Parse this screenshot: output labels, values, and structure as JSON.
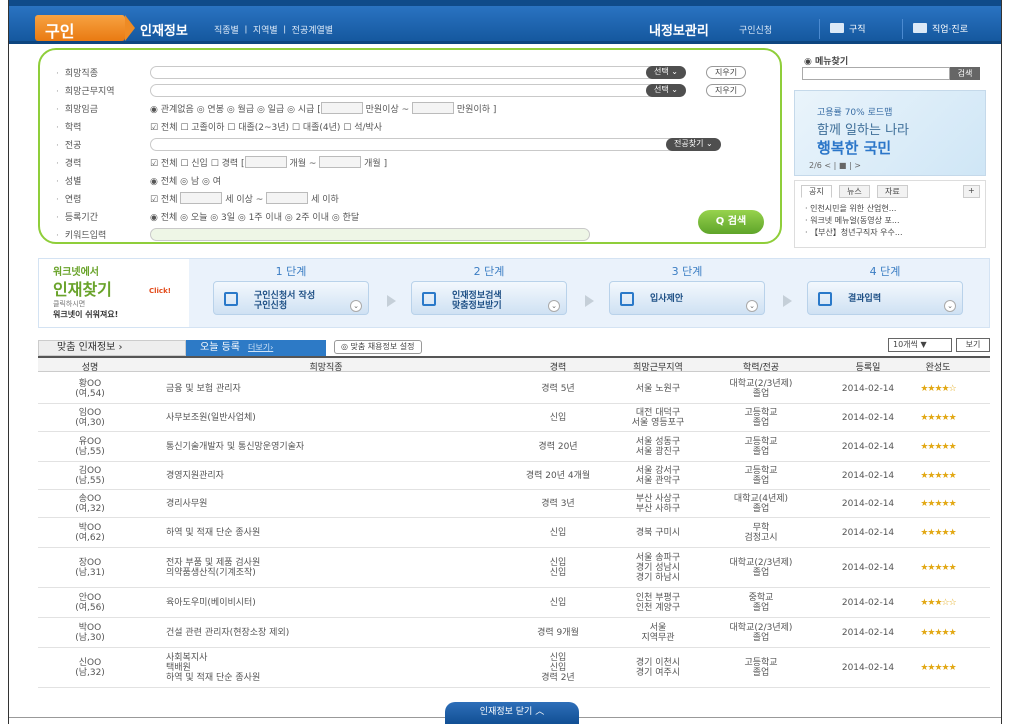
{
  "header": {
    "logo": "구인",
    "title": "인재정보",
    "subnav": "직종별 ㅣ 지역별 ㅣ 전공계열별",
    "my_info": "내정보관리",
    "request": "구인신청",
    "btn_jobs": "구직",
    "btn_career": "직업·진로",
    "colors": {
      "header_bg": "#1f66b3",
      "accent_green": "#8fce3a",
      "logo_orange": "#f19532"
    }
  },
  "search": {
    "fields": [
      {
        "label": "희망직종",
        "btn_select": "선택 ⌄",
        "btn_clear": "지우기"
      },
      {
        "label": "희망근무지역",
        "btn_select": "선택 ⌄",
        "btn_clear": "지우기"
      },
      {
        "label": "희망임금",
        "options": "◉ 관계없음  ◎ 연봉  ◎ 월급  ◎ 일급  ◎ 시급  [",
        "unit1": "만원이상 ~",
        "unit2": "만원이하 ]"
      },
      {
        "label": "학력",
        "options": "☑ 전체  ☐ 고졸이하  ☐ 대졸(2~3년)  ☐ 대졸(4년)  ☐ 석/박사"
      },
      {
        "label": "전공",
        "btn_find": "전공찾기 ⌄"
      },
      {
        "label": "경력",
        "options": "☑ 전체  ☐ 신입  ☐ 경력  [",
        "unit1": "개월 ~",
        "unit2": "개월 ]"
      },
      {
        "label": "성별",
        "options": "◉ 전체  ◎ 남  ◎ 여"
      },
      {
        "label": "연령",
        "options": "☑ 전체",
        "unit1": "세 이상 ~",
        "unit2": "세 이하"
      },
      {
        "label": "등록기간",
        "options": "◉ 전체  ◎ 오늘  ◎ 3일  ◎ 1주 이내  ◎ 2주 이내  ◎ 한달"
      },
      {
        "label": "키워드입력"
      }
    ],
    "search_button": "Q 검색"
  },
  "sidebar": {
    "menu_find_title": "◉ 메뉴찾기",
    "menu_find_button": "검색",
    "banner": {
      "line1": "고용률 70% 로드맵",
      "line2": "함께 일하는 나라",
      "line3": "행복한 국민",
      "pager": "2/6  < | ■ | >"
    },
    "news_tabs": [
      "공지",
      "뉴스",
      "자료",
      "+"
    ],
    "news_items": [
      "· 인천시민을 위한 산업현...",
      "· 워크넷 메뉴얼(동영상 포...",
      "· 【부산】청년구직자 우수..."
    ]
  },
  "steps": {
    "intro": {
      "line1": "워크넷에서",
      "line2": "인재찾기",
      "click": "Click!",
      "line3": "클릭하시면",
      "line4": "워크넷이 쉬워져요!"
    },
    "items": [
      {
        "num": "1 단계",
        "text": "구인신청서 작성\n구인신청"
      },
      {
        "num": "2 단계",
        "text": "인재정보검색\n맞춤정보받기"
      },
      {
        "num": "3 단계",
        "text": "입사제안"
      },
      {
        "num": "4 단계",
        "text": "결과입력"
      }
    ]
  },
  "tabs": {
    "tab1": "맞춤 인재정보 ›",
    "tab2": "오늘 등록",
    "tab2_more": "더보기›",
    "tab3": "◎ 맞춤 채용정보 설정",
    "select": "10개씩 ▼",
    "view": "보기"
  },
  "table": {
    "headers": [
      "성명",
      "희망직종",
      "경력",
      "희망근무지역",
      "학력/전공",
      "등록일",
      "완성도"
    ],
    "rows": [
      {
        "name": "황OO\n(여,54)",
        "job": "금융 및 보험 관리자",
        "career": "경력 5년",
        "region": "서울 노원구",
        "edu": "대학교(2/3년제)\n졸업",
        "date": "2014-02-14",
        "stars": "★★★★☆"
      },
      {
        "name": "임OO\n(여,30)",
        "job": "사무보조원(일반사업체)",
        "career": "신입",
        "region": "대전 대덕구\n서울 영등포구",
        "edu": "고등학교\n졸업",
        "date": "2014-02-14",
        "stars": "★★★★★"
      },
      {
        "name": "유OO\n(남,55)",
        "job": "통신기술개발자 및 통신망운영기술자",
        "career": "경력 20년",
        "region": "서울 성동구\n서울 광진구",
        "edu": "고등학교\n졸업",
        "date": "2014-02-14",
        "stars": "★★★★★"
      },
      {
        "name": "김OO\n(남,55)",
        "job": "경영지원관리자",
        "career": "경력 20년 4개월",
        "region": "서울 강서구\n서울 관악구",
        "edu": "고등학교\n졸업",
        "date": "2014-02-14",
        "stars": "★★★★★"
      },
      {
        "name": "송OO\n(여,32)",
        "job": "경리사무원",
        "career": "경력 3년",
        "region": "부산 사상구\n부산 사하구",
        "edu": "대학교(4년제)\n졸업",
        "date": "2014-02-14",
        "stars": "★★★★★"
      },
      {
        "name": "박OO\n(여,62)",
        "job": "하역 및 적재 단순 종사원",
        "career": "신입",
        "region": "경북 구미시",
        "edu": "무학\n검정고시",
        "date": "2014-02-14",
        "stars": "★★★★★"
      },
      {
        "name": "장OO\n(남,31)",
        "job": "전자 부품 및 제품 검사원\n의약품생산직(기계조작)",
        "career": "신입\n신입",
        "region": "서울 송파구\n경기 성남시\n경기 하남시",
        "edu": "대학교(2/3년제)\n졸업",
        "date": "2014-02-14",
        "stars": "★★★★★"
      },
      {
        "name": "안OO\n(여,56)",
        "job": "육아도우미(베이비시터)",
        "career": "신입",
        "region": "인천 부평구\n인천 계양구",
        "edu": "중학교\n졸업",
        "date": "2014-02-14",
        "stars": "★★★☆☆"
      },
      {
        "name": "박OO\n(남,30)",
        "job": "건설 관련 관리자(현장소장 제외)",
        "career": "경력 9개월",
        "region": "서울\n지역무관",
        "edu": "대학교(2/3년제)\n졸업",
        "date": "2014-02-14",
        "stars": "★★★★★"
      },
      {
        "name": "신OO\n(남,32)",
        "job": "사회복지사\n택배원\n하역 및 적재 단순 종사원",
        "career": "신입\n신입\n경력 2년",
        "region": "경기 이천시\n경기 여주시",
        "edu": "고등학교\n졸업",
        "date": "2014-02-14",
        "stars": "★★★★★"
      }
    ]
  },
  "footer": {
    "close": "인재정보 닫기 ︿"
  }
}
